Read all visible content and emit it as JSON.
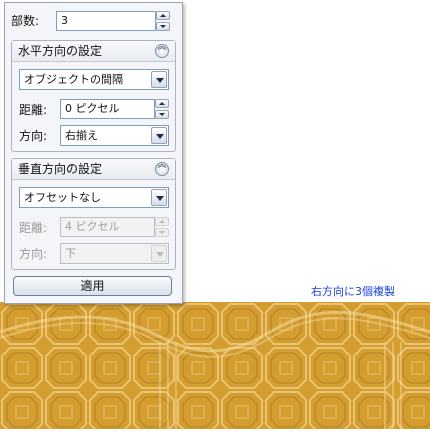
{
  "panel": {
    "copies": {
      "label": "部数:",
      "value": "3"
    },
    "horizontal": {
      "title": "水平方向の設定",
      "mode": "オブジェクトの間隔",
      "distance_label": "距離:",
      "distance_value": "0 ピクセル",
      "direction_label": "方向:",
      "direction_value": "右揃え"
    },
    "vertical": {
      "title": "垂直方向の設定",
      "mode": "オフセットなし",
      "distance_label": "距離:",
      "distance_value": "4 ピクセル",
      "direction_label": "方向:",
      "direction_value": "下"
    },
    "apply_label": "適用"
  },
  "caption": "右方向に3個複製",
  "colors": {
    "pattern_fill": "#d39d2f",
    "caption": "#1c3fe0",
    "panel_bg": "#f4f5f8"
  }
}
